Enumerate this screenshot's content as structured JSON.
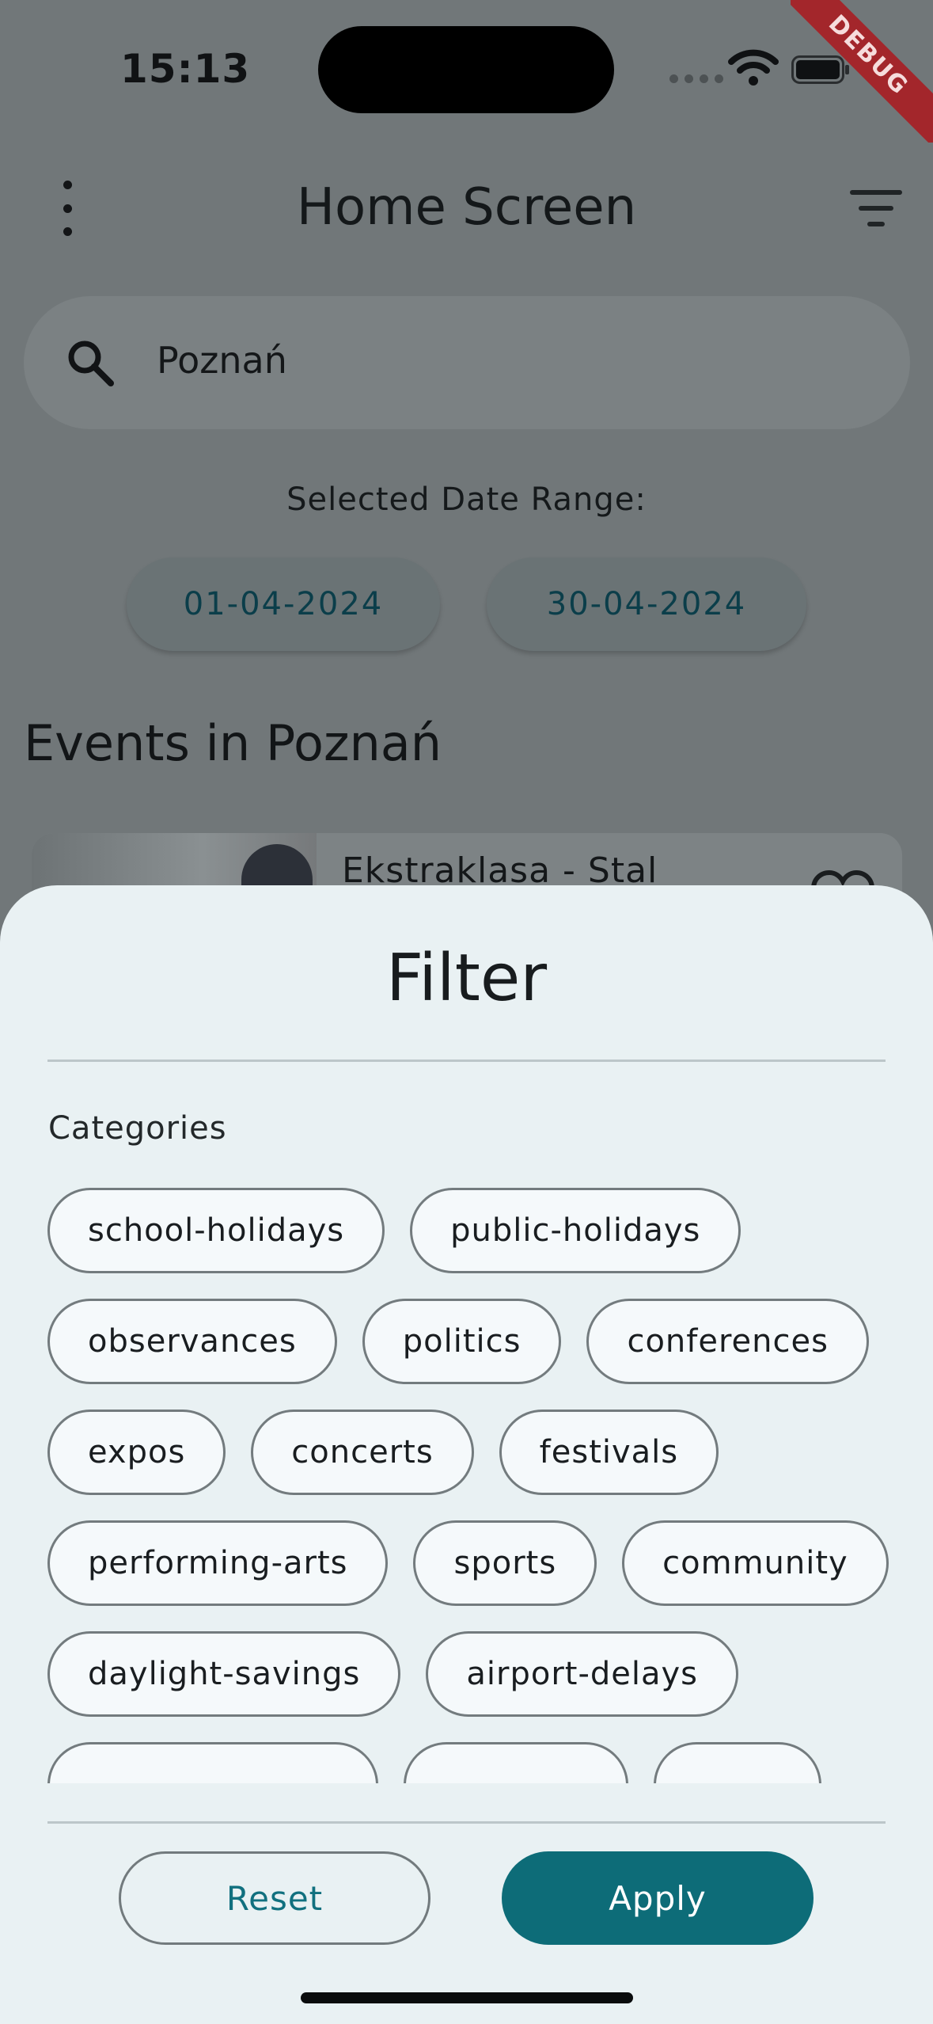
{
  "status_bar": {
    "time": "15:13",
    "debug_banner": "DEBUG"
  },
  "app_bar": {
    "title": "Home Screen",
    "menu_icon": "more-vert-icon",
    "filter_icon": "filter-list-icon"
  },
  "search": {
    "value": "Poznań",
    "icon": "search-icon"
  },
  "date_range": {
    "label": "Selected Date Range:",
    "start": "01-04-2024",
    "end": "30-04-2024"
  },
  "events": {
    "title": "Events in Poznań",
    "first_card_title": "Ekstraklasa - Stal"
  },
  "filter_sheet": {
    "title": "Filter",
    "categories_label": "Categories",
    "categories": [
      "school-holidays",
      "public-holidays",
      "observances",
      "politics",
      "conferences",
      "expos",
      "concerts",
      "festivals",
      "performing-arts",
      "sports",
      "community",
      "daylight-savings",
      "airport-delays",
      "",
      "",
      ""
    ],
    "reset_label": "Reset",
    "apply_label": "Apply"
  },
  "colors": {
    "accent": "#0d6c78",
    "sheet_bg": "#e9f1f3",
    "scrim": "#717779"
  }
}
